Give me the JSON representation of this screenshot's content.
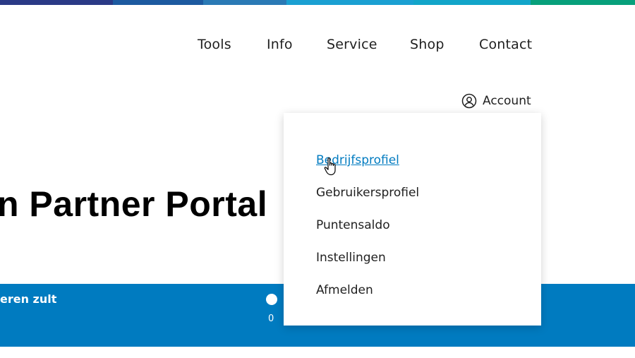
{
  "top_bar_colors": [
    "#2a3a86",
    "#1d5aa0",
    "#2a7ab5",
    "#1aa0d2",
    "#12a5c9",
    "#07a07b"
  ],
  "nav": {
    "items": [
      {
        "label": "Tools"
      },
      {
        "label": "Info"
      },
      {
        "label": "Service"
      },
      {
        "label": "Shop"
      },
      {
        "label": "Contact"
      }
    ]
  },
  "account": {
    "label": "Account",
    "icon": "user-circle-icon"
  },
  "hero": {
    "title": "n Partner Portal"
  },
  "band": {
    "text": "eren zult",
    "count": "0",
    "color": "#007bc0"
  },
  "account_menu": {
    "items": [
      {
        "label": "Bedrijfsprofiel",
        "state": "hover"
      },
      {
        "label": "Gebruikersprofiel"
      },
      {
        "label": "Puntensaldo"
      },
      {
        "label": "Instellingen"
      },
      {
        "label": "Afmelden"
      }
    ]
  }
}
